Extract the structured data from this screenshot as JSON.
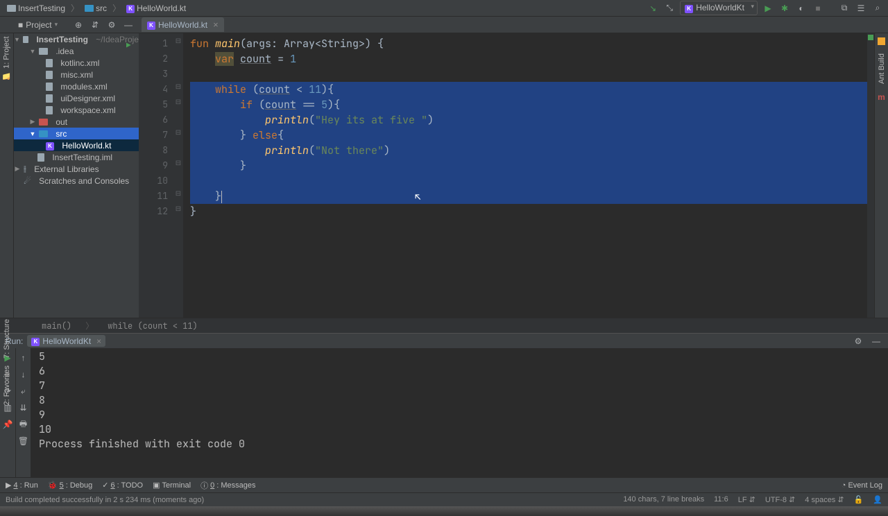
{
  "breadcrumb": {
    "project": "InsertTesting",
    "folder": "src",
    "file": "HelloWorld.kt"
  },
  "run_config": "HelloWorldKt",
  "project_label": "Project",
  "project_home": "~/IdeaProje",
  "tree": {
    "root": "InsertTesting",
    "idea": ".idea",
    "idea_files": [
      "kotlinc.xml",
      "misc.xml",
      "modules.xml",
      "uiDesigner.xml",
      "workspace.xml"
    ],
    "out": "out",
    "src": "src",
    "src_file": "HelloWorld.kt",
    "iml": "InsertTesting.iml",
    "ext_libs": "External Libraries",
    "scratches": "Scratches and Consoles"
  },
  "editor_tab": "HelloWorld.kt",
  "code": {
    "l1_fun": "fun",
    "l1_main": "main",
    "l1_params": "(args: Array<String>) {",
    "l2_var": "var",
    "l2_name": "count",
    "l2_rest": " = ",
    "l2_val": "1",
    "l4_while": "while",
    "l4_open": " (",
    "l4_count": "count",
    "l4_op": " < ",
    "l4_num": "11",
    "l4_close": "){",
    "l5_if": "if",
    "l5_open": " (",
    "l5_count": "count",
    "l5_eq": " == ",
    "l5_num": "5",
    "l5_close": "){",
    "l6_pr": "println",
    "l6_op": "(",
    "l6_str": "\"Hey its at five \"",
    "l6_cl": ")",
    "l7_close": "} ",
    "l7_else": "else",
    "l7_open": "{",
    "l8_pr": "println",
    "l8_op": "(",
    "l8_str": "\"Not there\"",
    "l8_cl": ")",
    "l9_close": "}",
    "l11_close": "}",
    "l12_close": "}"
  },
  "crumbs": {
    "a": "main()",
    "b": "while (count < 11)"
  },
  "run_panel": {
    "label": "Run:",
    "tab": "HelloWorldKt"
  },
  "console": [
    "5",
    "6",
    "7",
    "8",
    "9",
    "10",
    "",
    "Process finished with exit code 0"
  ],
  "bottom_tabs": {
    "run": "4: Run",
    "debug": "5: Debug",
    "todo": "6: TODO",
    "terminal": "Terminal",
    "messages": "0: Messages",
    "event_log": "Event Log"
  },
  "status": {
    "msg": "Build completed successfully in 2 s 234 ms (moments ago)",
    "chars": "140 chars, 7 line breaks",
    "pos": "11:6",
    "lf": "LF",
    "enc": "UTF-8",
    "spaces": "4 spaces"
  },
  "side": {
    "project": "1: Project",
    "structure": "7: Structure",
    "favorites": "2: Favorites",
    "ant": "Ant Build",
    "maven": "m"
  }
}
